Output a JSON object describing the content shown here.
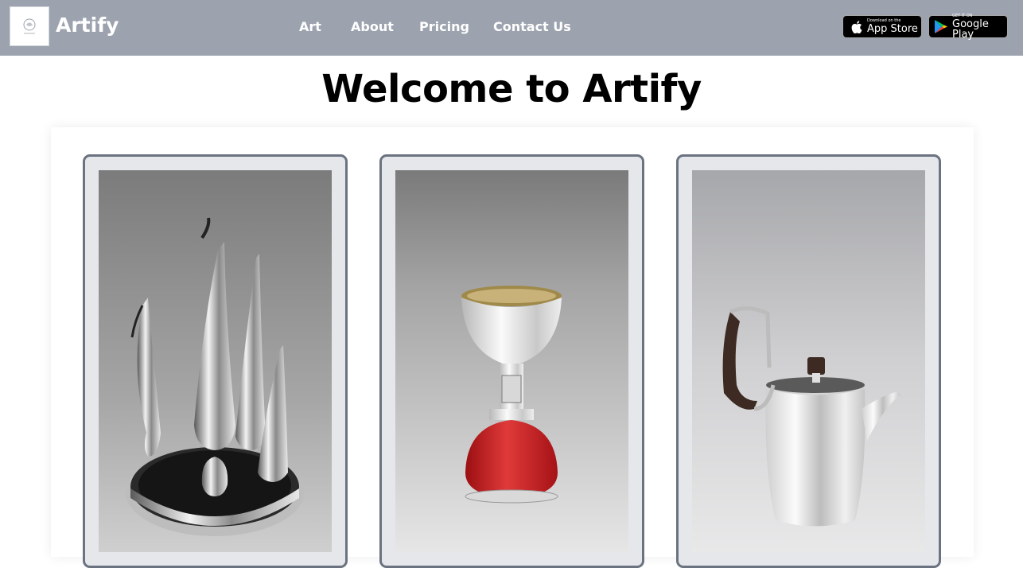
{
  "header": {
    "brand": "Artify",
    "logo_icon": "artify-logo-icon",
    "nav": [
      {
        "label": "Art"
      },
      {
        "label": "About"
      },
      {
        "label": "Pricing"
      },
      {
        "label": "Contact Us"
      }
    ],
    "app_store": {
      "small": "Download on the",
      "big": "App Store",
      "icon": "apple-icon"
    },
    "google_play": {
      "small": "GET IT ON",
      "big": "Google Play",
      "icon": "play-store-icon"
    }
  },
  "main": {
    "title": "Welcome to Artify",
    "artworks": [
      {
        "subject": "silver pitcher and vase set on tray"
      },
      {
        "subject": "silver goblet on red base"
      },
      {
        "subject": "silver teapot with dark wooden handle"
      }
    ]
  },
  "colors": {
    "navbar_bg": "#9ca3af",
    "card_bg": "#e5e7eb",
    "card_border": "#6b7280"
  }
}
